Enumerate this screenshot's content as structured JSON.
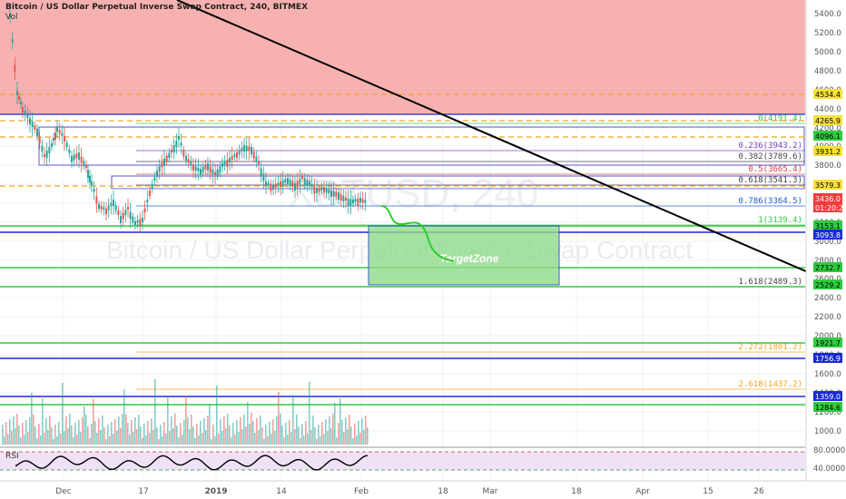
{
  "header": {
    "title": "Bitcoin / US Dollar Perpetual Inverse Swap Contract, 240, BITMEX",
    "volume_label": "Vol"
  },
  "watermark": {
    "symbol": "XBTUSD, 240",
    "name": "Bitcoin / US Dollar Perpetual Inverse Swap Contract"
  },
  "target_zone_label": "TargetZone",
  "rsi_label": "RSI",
  "colors": {
    "resistance_zone": "#f7a3a3",
    "target_zone": "#8fdc8a",
    "support_line": "#2ecc3f",
    "blue_line": "#1a2bd6",
    "orange_dashed": "#f2a422",
    "trendline": "#000000",
    "candle_up": "#26a69a",
    "candle_down": "#ef5350",
    "rsi_fill": "#efe2f7",
    "rsi_line": "#000000"
  },
  "chart_data": {
    "type": "candlestick",
    "x_axis_ticks": [
      "Dec",
      "17",
      "2019",
      "14",
      "Feb",
      "18",
      "Mar",
      "18",
      "Apr",
      "15",
      "26"
    ],
    "y_axis": {
      "scale": "log",
      "ticks": [
        "5400.0",
        "5200.0",
        "5000.0",
        "4800.0",
        "4600.0",
        "4400.0",
        "4200.0",
        "4000.0",
        "3800.0",
        "3600.0",
        "3400.0",
        "3200.0",
        "3000.0",
        "2800.0",
        "2600.0",
        "2400.0",
        "2200.0",
        "2000.0",
        "1800.0",
        "1600.0",
        "1400.0",
        "1200.0",
        "1000.0"
      ]
    },
    "fib_levels": [
      {
        "label": "0(4191.4)",
        "color": "#2ecc3f"
      },
      {
        "label": "0.236(3943.2)",
        "color": "#7b3fb8"
      },
      {
        "label": "0.382(3789.6)",
        "color": "#444444"
      },
      {
        "label": "0.5(3665.4)",
        "color": "#d64545"
      },
      {
        "label": "0.618(3541.3)",
        "color": "#444444"
      },
      {
        "label": "0.786(3364.5)",
        "color": "#1a5bd6"
      },
      {
        "label": "1(3139.4)",
        "color": "#2ecc3f"
      },
      {
        "label": "1.618(2489.3)",
        "color": "#444444"
      },
      {
        "label": "2.272(1801.2)",
        "color": "#f2a422"
      },
      {
        "label": "2.618(1437.2)",
        "color": "#f2a422"
      }
    ],
    "price_tags": [
      {
        "value": "4534.4",
        "bg": "#f7e03a",
        "fg": "#000000"
      },
      {
        "value": "4265.9",
        "bg": "#f7e03a",
        "fg": "#000000"
      },
      {
        "value": "4096.1",
        "bg": "#2ecc3f",
        "fg": "#000000"
      },
      {
        "value": "3931.2",
        "bg": "#f7e03a",
        "fg": "#000000"
      },
      {
        "value": "3579.3",
        "bg": "#f7e03a",
        "fg": "#000000"
      },
      {
        "value": "3436.0",
        "bg": "#ef3d3d",
        "fg": "#ffffff"
      },
      {
        "value": "01:20:21",
        "bg": "#ef3d3d",
        "fg": "#ffffff"
      },
      {
        "value": "3153.1",
        "bg": "#2ecc3f",
        "fg": "#000000"
      },
      {
        "value": "3093.8",
        "bg": "#1a2bd6",
        "fg": "#ffffff"
      },
      {
        "value": "2732.7",
        "bg": "#2ecc3f",
        "fg": "#000000"
      },
      {
        "value": "2529.2",
        "bg": "#2ecc3f",
        "fg": "#000000"
      },
      {
        "value": "1921.7",
        "bg": "#2ecc3f",
        "fg": "#000000"
      },
      {
        "value": "1756.9",
        "bg": "#1a2bd6",
        "fg": "#ffffff"
      },
      {
        "value": "1359.0",
        "bg": "#1a2bd6",
        "fg": "#ffffff"
      },
      {
        "value": "1284.6",
        "bg": "#2ecc3f",
        "fg": "#000000"
      }
    ],
    "rsi": {
      "ticks": [
        "80.0000",
        "40.0000"
      ],
      "upper": 70,
      "lower": 30
    },
    "title": "Bitcoin / US Dollar Perpetual Inverse Swap Contract, 240, BITMEX"
  }
}
